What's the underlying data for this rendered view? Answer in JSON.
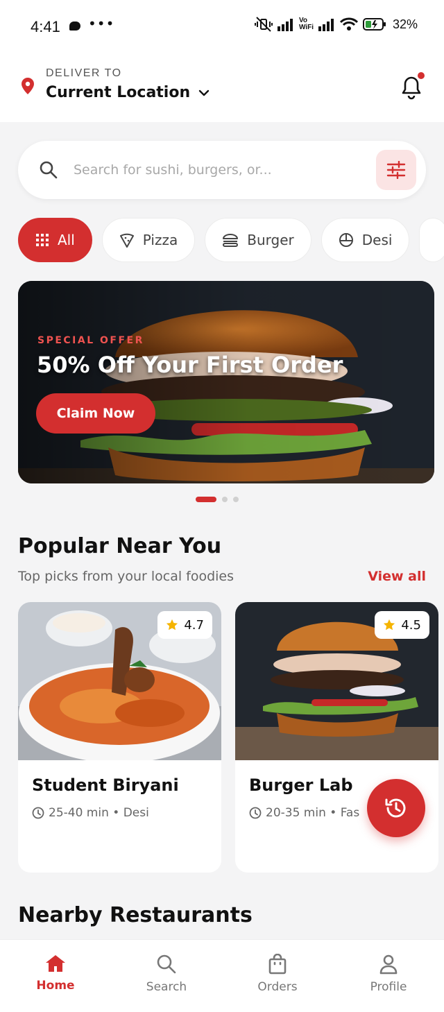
{
  "status_bar": {
    "time": "4:41",
    "dots": "•••",
    "vowifi_top": "Vo",
    "vowifi_bottom": "WiFi",
    "battery": "32%"
  },
  "header": {
    "deliver_label": "DELIVER TO",
    "location": "Current Location"
  },
  "search": {
    "placeholder": "Search for sushi, burgers, or..."
  },
  "categories": [
    {
      "label": "All",
      "icon": "grid-icon",
      "active": true
    },
    {
      "label": "Pizza",
      "icon": "pizza-icon"
    },
    {
      "label": "Burger",
      "icon": "burger-icon"
    },
    {
      "label": "Desi",
      "icon": "globe-bowl-icon"
    }
  ],
  "banner": {
    "eyebrow": "SPECIAL OFFER",
    "title": "50% Off Your First Order",
    "cta": "Claim Now",
    "slides": 3,
    "active_slide": 1
  },
  "popular": {
    "title": "Popular Near You",
    "subtitle": "Top picks from your local foodies",
    "view_all": "View all",
    "items": [
      {
        "name": "Student Biryani",
        "rating": "4.7",
        "meta": "25-40 min • Desi"
      },
      {
        "name": "Burger Lab",
        "rating": "4.5",
        "meta": "20-35 min • Fas"
      }
    ]
  },
  "nearby": {
    "title": "Nearby Restaurants"
  },
  "nav": [
    {
      "label": "Home",
      "icon": "home-icon",
      "active": true
    },
    {
      "label": "Search",
      "icon": "search-icon"
    },
    {
      "label": "Orders",
      "icon": "bag-icon"
    },
    {
      "label": "Profile",
      "icon": "user-icon"
    }
  ],
  "colors": {
    "accent": "#d32f2f",
    "accent_soft": "#fbe4e4",
    "background": "#f4f4f5",
    "star": "#f5b400"
  }
}
